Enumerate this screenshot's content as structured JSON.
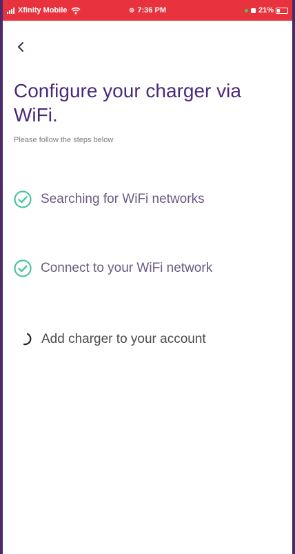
{
  "status_bar": {
    "carrier": "Xfinity Mobile",
    "time": "7:36 PM",
    "battery": "21%",
    "background_color": "#e8323d"
  },
  "header": {
    "back_icon": "chevron-left-icon",
    "title": "Configure your charger via WiFi.",
    "subtitle": "Please follow the steps below"
  },
  "steps": [
    {
      "label": "Searching for WiFi networks",
      "state": "done",
      "icon": "check-circle-icon"
    },
    {
      "label": "Connect to your WiFi network",
      "state": "done",
      "icon": "check-circle-icon"
    },
    {
      "label": "Add charger to your account",
      "state": "in-progress",
      "icon": "spinner-icon"
    }
  ],
  "colors": {
    "title": "#4a2a78",
    "check": "#4cc3a0",
    "step_text": "#6b5a80",
    "frame_border": "#4b2a6b"
  }
}
